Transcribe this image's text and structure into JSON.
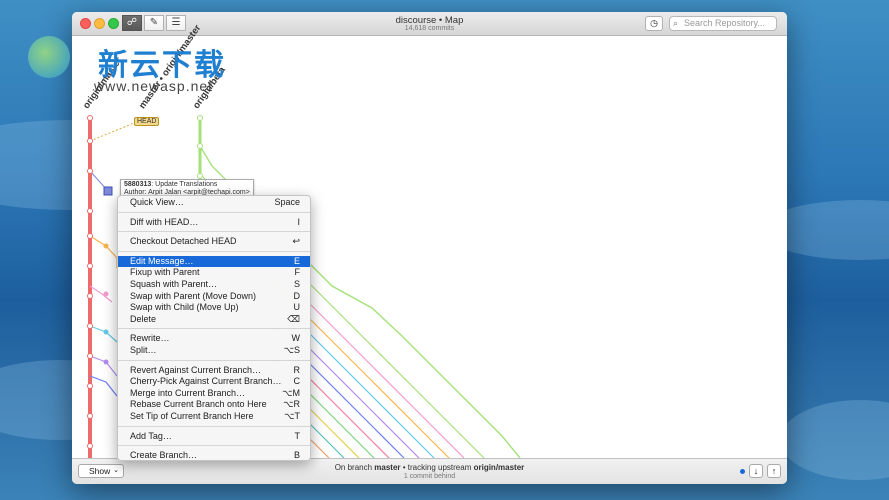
{
  "window": {
    "title": "discourse • Map",
    "subtitle": "14,618 commits",
    "search_placeholder": "Search Repository..."
  },
  "toolbar": {
    "view_icons": [
      "graph-icon",
      "compose-icon",
      "list-icon"
    ],
    "history_icon": "clock-icon"
  },
  "branches": [
    "origin/master",
    "master • origin/master",
    "origin/beta"
  ],
  "head_label": "HEAD",
  "commit_tooltip": {
    "sha": "5880313",
    "message": ": Update Translations",
    "author": "Author: Arpit Jalan <arpit@techapi.com>"
  },
  "context_menu": {
    "groups": [
      [
        {
          "label": "Quick View…",
          "shortcut": "Space"
        }
      ],
      [
        {
          "label": "Diff with HEAD…",
          "shortcut": "I"
        }
      ],
      [
        {
          "label": "Checkout Detached HEAD",
          "shortcut": "↩"
        }
      ],
      [
        {
          "label": "Edit Message…",
          "shortcut": "E",
          "highlighted": true
        },
        {
          "label": "Fixup with Parent",
          "shortcut": "F"
        },
        {
          "label": "Squash with Parent…",
          "shortcut": "S"
        },
        {
          "label": "Swap with Parent (Move Down)",
          "shortcut": "D"
        },
        {
          "label": "Swap with Child (Move Up)",
          "shortcut": "U"
        },
        {
          "label": "Delete",
          "shortcut": "⌫"
        }
      ],
      [
        {
          "label": "Rewrite…",
          "shortcut": "W"
        },
        {
          "label": "Split…",
          "shortcut": "⌥S"
        }
      ],
      [
        {
          "label": "Revert Against Current Branch…",
          "shortcut": "R"
        },
        {
          "label": "Cherry-Pick Against Current Branch…",
          "shortcut": "C"
        },
        {
          "label": "Merge into Current Branch…",
          "shortcut": "⌥M"
        },
        {
          "label": "Rebase Current Branch onto Here",
          "shortcut": "⌥R"
        },
        {
          "label": "Set Tip of Current Branch Here",
          "shortcut": "⌥T"
        }
      ],
      [
        {
          "label": "Add Tag…",
          "shortcut": "T"
        }
      ],
      [
        {
          "label": "Create Branch…",
          "shortcut": "B"
        }
      ]
    ]
  },
  "footer": {
    "show_label": "Show",
    "status_prefix": "On branch ",
    "status_branch": "master",
    "status_middle": " • tracking upstream ",
    "status_upstream": "origin/master",
    "status_sub": "1 commit behind"
  },
  "watermark": {
    "cn": "新云下载",
    "url": "www.newasp.net"
  },
  "colors": {
    "accent": "#1768d8",
    "lane_red": "#ee6b6b",
    "lane_green": "#a6e07a"
  }
}
